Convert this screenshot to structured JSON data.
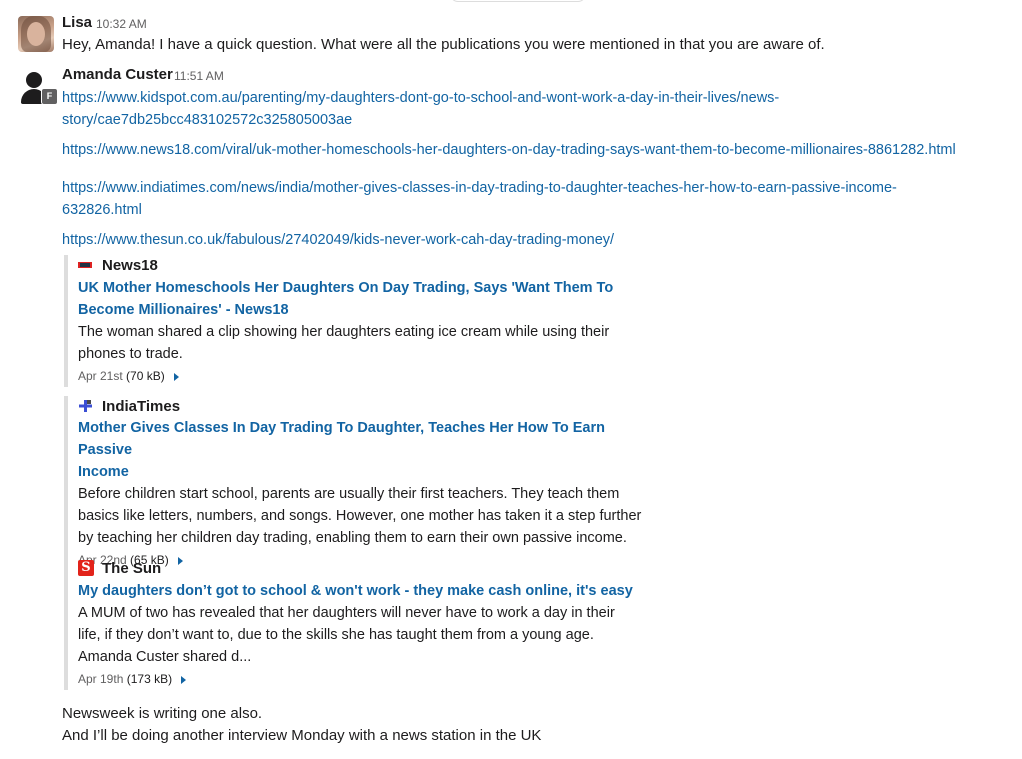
{
  "messages": [
    {
      "author": "Lisa",
      "time": "10:32 AM",
      "text": "Hey, Amanda! I have a quick question. What were all the publications you were mentioned in that you are aware of."
    },
    {
      "author": "Amanda Custer",
      "time": "11:51 AM",
      "badge": "F",
      "links": [
        {
          "line1": "https://www.kidspot.com.au/parenting/my-daughters-dont-go-to-school-and-wont-work-a-day-in-their-lives/news-",
          "line2": "story/cae7db25bcc483102572c325805003ae"
        },
        {
          "line1": "https://www.news18.com/viral/uk-mother-homeschools-her-daughters-on-day-trading-says-want-them-to-become-millionaires-8861282.html"
        },
        {
          "line1": "https://www.indiatimes.com/news/india/mother-gives-classes-in-day-trading-to-daughter-teaches-her-how-to-earn-passive-income-",
          "line2": "632826.html"
        },
        {
          "line1": "https://www.thesun.co.uk/fabulous/27402049/kids-never-work-cah-day-trading-money/"
        }
      ],
      "attachments": [
        {
          "source": "News18",
          "icon": "news18-logo-icon",
          "title_lines": [
            "UK Mother Homeschools Her Daughters On Day Trading, Says 'Want Them To",
            "Become Millionaires' - News18"
          ],
          "desc_lines": [
            "The woman shared a clip showing her daughters eating ice cream while using their",
            "phones to trade."
          ],
          "date": "Apr 21st",
          "size": "(70 kB)"
        },
        {
          "source": "IndiaTimes",
          "icon": "indiatimes-logo-icon",
          "title_lines": [
            "Mother Gives Classes In Day Trading To Daughter, Teaches Her How To Earn Passive",
            "Income"
          ],
          "desc_lines": [
            "Before children start school, parents are usually their first teachers. They teach them",
            "basics like letters, numbers, and songs. However, one mother has taken it a step further",
            "by teaching her children day trading, enabling them to earn their own passive income."
          ],
          "date": "Apr 22nd",
          "size": "(65 kB)"
        },
        {
          "source": "The Sun",
          "icon": "the-sun-logo-icon",
          "title_lines": [
            "My daughters don’t got to school & won't work - they make cash online, it's easy"
          ],
          "desc_lines": [
            "A MUM of two has revealed that her daughters will never have to work a day in their",
            "life, if they don’t want to, due to the skills she has taught them from a young age.",
            "Amanda Custer shared d..."
          ],
          "date": "Apr 19th",
          "size": "(173 kB)"
        }
      ],
      "followups": [
        "Newsweek is writing one also.",
        "And I’ll be doing another interview Monday with a news station in the UK"
      ]
    }
  ]
}
